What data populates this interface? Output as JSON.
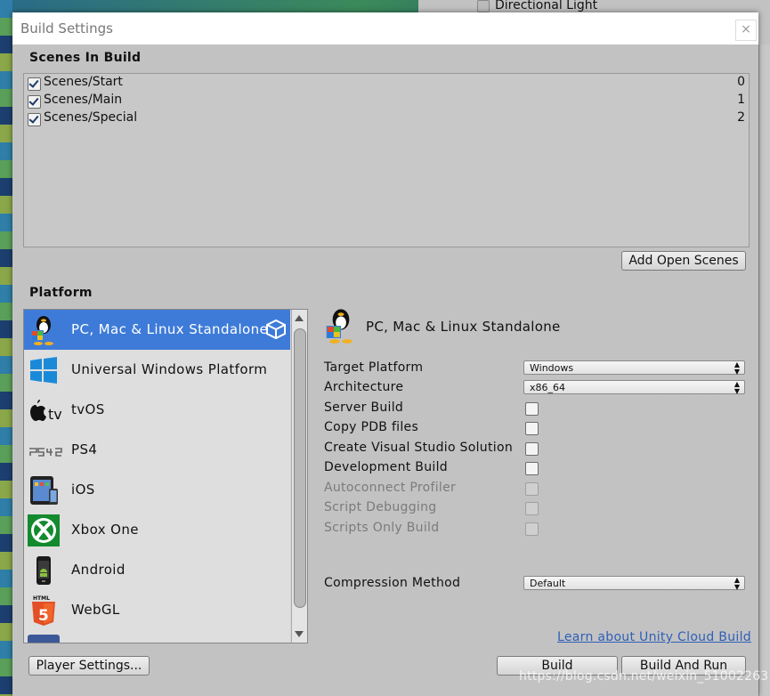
{
  "background": {
    "hierarchy_item": "Directional Light"
  },
  "window": {
    "title": "Build Settings",
    "close_label": "×"
  },
  "scenes": {
    "header": "Scenes In Build",
    "items": [
      {
        "name": "Scenes/Start",
        "index": "0",
        "checked": true
      },
      {
        "name": "Scenes/Main",
        "index": "1",
        "checked": true
      },
      {
        "name": "Scenes/Special",
        "index": "2",
        "checked": true
      }
    ],
    "add_open_scenes": "Add Open Scenes"
  },
  "platform": {
    "header": "Platform",
    "items": [
      {
        "label": "PC, Mac & Linux Standalone",
        "icon": "pc-mac-linux-icon",
        "selected": true
      },
      {
        "label": "Universal Windows Platform",
        "icon": "windows-logo-icon"
      },
      {
        "label": "tvOS",
        "icon": "apple-tv-icon"
      },
      {
        "label": "PS4",
        "icon": "ps4-logo-icon"
      },
      {
        "label": "iOS",
        "icon": "ipad-icon"
      },
      {
        "label": "Xbox One",
        "icon": "xbox-logo-icon"
      },
      {
        "label": "Android",
        "icon": "android-phone-icon"
      },
      {
        "label": "WebGL",
        "icon": "html5-icon"
      }
    ]
  },
  "details": {
    "title": "PC, Mac & Linux Standalone",
    "target_platform_label": "Target Platform",
    "target_platform_value": "Windows",
    "architecture_label": "Architecture",
    "architecture_value": "x86_64",
    "server_build": "Server Build",
    "copy_pdb": "Copy PDB files",
    "create_vs": "Create Visual Studio Solution",
    "development_build": "Development Build",
    "autoconnect_profiler": "Autoconnect Profiler",
    "script_debugging": "Script Debugging",
    "scripts_only_build": "Scripts Only Build",
    "compression_label": "Compression Method",
    "compression_value": "Default",
    "cloud_link": "Learn about Unity Cloud Build"
  },
  "footer": {
    "player_settings": "Player Settings...",
    "build": "Build",
    "build_and_run": "Build And Run"
  },
  "watermark": "https://blog.csdn.net/weixin_51002263",
  "colors": {
    "selection": "#3e7bd8",
    "window_bg": "#c2c2c2",
    "link": "#2f5fb8"
  }
}
